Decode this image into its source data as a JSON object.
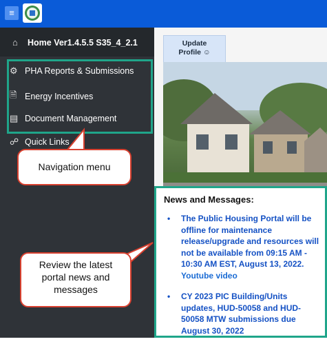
{
  "header": {
    "menu_icon": "hamburger-icon",
    "logo": "hud-logo"
  },
  "sidebar": {
    "home": {
      "label": "Home Ver1.4.5.5 S35_4_2.1",
      "icon": "home-icon"
    },
    "items": [
      {
        "label": "PHA Reports & Submissions",
        "icon": "gear-icon"
      },
      {
        "label": "Energy Incentives",
        "icon": "document-icon"
      },
      {
        "label": "Document Management",
        "icon": "folder-icon"
      },
      {
        "label": "Quick Links",
        "icon": "link-icon"
      }
    ]
  },
  "callouts": {
    "nav": "Navigation menu",
    "news_line1": "Review the latest",
    "news_line2": "portal news and",
    "news_line3": "messages"
  },
  "main": {
    "tab": {
      "line1": "Update",
      "line2": "Profile",
      "icon": "user-icon"
    },
    "news": {
      "title": "News and Messages:",
      "items": [
        {
          "text": "The Public Housing Portal will be offline for maintenance release/upgrade and resources will not be available from 09:15 AM - 10:30 AM EST, August 13, 2022.",
          "link": "Youtube video"
        },
        {
          "text": "CY 2023 PIC Building/Units updates, HUD-50058 and HUD-50058 MTW submissions due August 30, 2022"
        }
      ]
    }
  },
  "colors": {
    "topbar": "#0a5bd8",
    "sidebar": "#2f3338",
    "highlight": "#1fa58a",
    "callout_border": "#d8402f",
    "link": "#1451c4"
  }
}
